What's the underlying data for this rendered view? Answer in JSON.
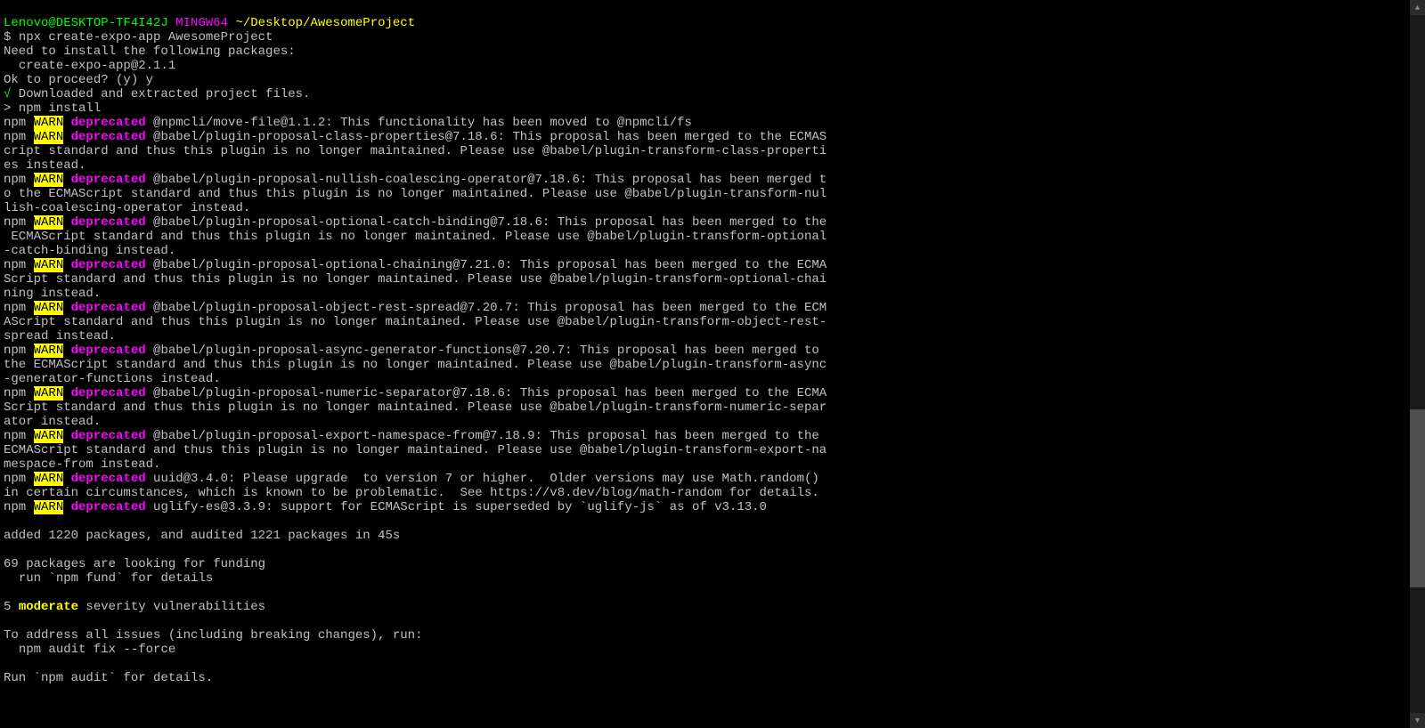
{
  "prompt": {
    "user": "Lenovo@DESKTOP-TF4I42J",
    "system": "MINGW64",
    "path": "~/Desktop/AwesomeProject"
  },
  "cmd": {
    "symbol": "$ ",
    "text": "npx create-expo-app AwesomeProject"
  },
  "lines": {
    "install_needed": "Need to install the following packages:",
    "install_pkg": "  create-expo-app@2.1.1",
    "proceed": "Ok to proceed? (y) y",
    "check": "√",
    "downloaded": " Downloaded and extracted project files.",
    "npm_install": "> npm install"
  },
  "warn_label": {
    "npm": "npm ",
    "warn": "WARN",
    "depr": " deprecated "
  },
  "warns": [
    "@npmcli/move-file@1.1.2: This functionality has been moved to @npmcli/fs",
    "@babel/plugin-proposal-class-properties@7.18.6: This proposal has been merged to the ECMAScript standard and thus this plugin is no longer maintained. Please use @babel/plugin-transform-class-properties instead.",
    "@babel/plugin-proposal-nullish-coalescing-operator@7.18.6: This proposal has been merged to the ECMAScript standard and thus this plugin is no longer maintained. Please use @babel/plugin-transform-nullish-coalescing-operator instead.",
    "@babel/plugin-proposal-optional-catch-binding@7.18.6: This proposal has been merged to the ECMAScript standard and thus this plugin is no longer maintained. Please use @babel/plugin-transform-optional-catch-binding instead.",
    "@babel/plugin-proposal-optional-chaining@7.21.0: This proposal has been merged to the ECMAScript standard and thus this plugin is no longer maintained. Please use @babel/plugin-transform-optional-chaining instead.",
    "@babel/plugin-proposal-object-rest-spread@7.20.7: This proposal has been merged to the ECMAScript standard and thus this plugin is no longer maintained. Please use @babel/plugin-transform-object-rest-spread instead.",
    "@babel/plugin-proposal-async-generator-functions@7.20.7: This proposal has been merged to the ECMAScript standard and thus this plugin is no longer maintained. Please use @babel/plugin-transform-async-generator-functions instead.",
    "@babel/plugin-proposal-numeric-separator@7.18.6: This proposal has been merged to the ECMAScript standard and thus this plugin is no longer maintained. Please use @babel/plugin-transform-numeric-separator instead.",
    "@babel/plugin-proposal-export-namespace-from@7.18.9: This proposal has been merged to the ECMAScript standard and thus this plugin is no longer maintained. Please use @babel/plugin-transform-export-namespace-from instead.",
    "uuid@3.4.0: Please upgrade  to version 7 or higher.  Older versions may use Math.random() in certain circumstances, which is known to be problematic.  See https://v8.dev/blog/math-random for details.",
    "uglify-es@3.3.9: support for ECMAScript is superseded by `uglify-js` as of v3.13.0"
  ],
  "footer": {
    "blank": "",
    "added": "added 1220 packages, and audited 1221 packages in 45s",
    "funding1": "69 packages are looking for funding",
    "funding2": "  run `npm fund` for details",
    "vuln_prefix": "5 ",
    "vuln_word": "moderate",
    "vuln_suffix": " severity vulnerabilities",
    "address": "To address all issues (including breaking changes), run:",
    "fix": "  npm audit fix --force",
    "audit": "Run `npm audit` for details."
  },
  "wrap_width": 110
}
